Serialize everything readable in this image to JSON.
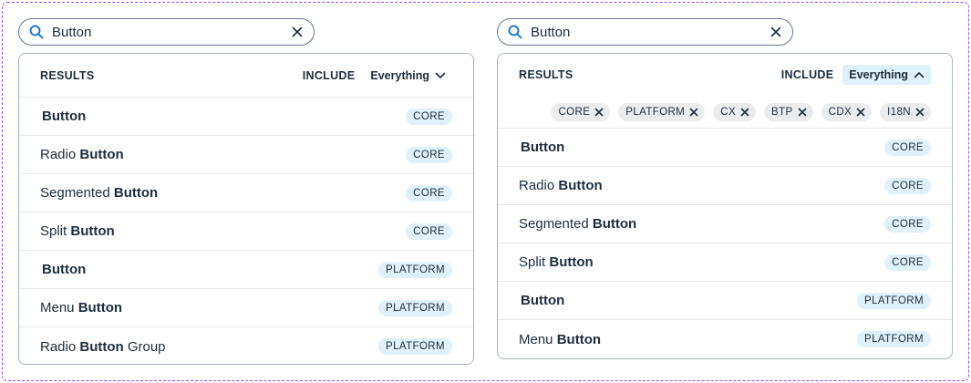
{
  "left": {
    "search": {
      "value": "Button"
    },
    "results_label": "RESULTS",
    "include_label": "INCLUDE",
    "include_value": "Everything",
    "rows": [
      {
        "pre": "",
        "match": "Button",
        "post": "",
        "tag": "CORE"
      },
      {
        "pre": "Radio ",
        "match": "Button",
        "post": "",
        "tag": "CORE"
      },
      {
        "pre": "Segmented ",
        "match": "Button",
        "post": "",
        "tag": "CORE"
      },
      {
        "pre": "Split ",
        "match": "Button",
        "post": "",
        "tag": "CORE"
      },
      {
        "pre": "",
        "match": "Button",
        "post": "",
        "tag": "PLATFORM"
      },
      {
        "pre": "Menu ",
        "match": "Button",
        "post": "",
        "tag": "PLATFORM"
      },
      {
        "pre": "Radio ",
        "match": "Button",
        "post": " Group",
        "tag": "PLATFORM"
      }
    ]
  },
  "right": {
    "search": {
      "value": "Button"
    },
    "results_label": "RESULTS",
    "include_label": "INCLUDE",
    "include_value": "Everything",
    "chips": [
      "CORE",
      "PLATFORM",
      "CX",
      "BTP",
      "CDX",
      "I18N"
    ],
    "rows": [
      {
        "pre": "",
        "match": "Button",
        "post": "",
        "tag": "CORE"
      },
      {
        "pre": "Radio ",
        "match": "Button",
        "post": "",
        "tag": "CORE"
      },
      {
        "pre": "Segmented ",
        "match": "Button",
        "post": "",
        "tag": "CORE"
      },
      {
        "pre": "Split ",
        "match": "Button",
        "post": "",
        "tag": "CORE"
      },
      {
        "pre": "",
        "match": "Button",
        "post": "",
        "tag": "PLATFORM"
      },
      {
        "pre": "Menu ",
        "match": "Button",
        "post": "",
        "tag": "PLATFORM"
      }
    ]
  },
  "colors": {
    "accent_frame": "#9747ff",
    "tag_bg": "#dff1fa",
    "chip_bg": "#eaecee",
    "text": "#1d2d3e",
    "search_icon": "#0a6ed1"
  },
  "icons": {
    "search": "search-icon",
    "clear": "close-icon",
    "chevron_closed": "chevron-down-icon",
    "chevron_open": "chevron-up-icon",
    "chip_remove": "close-icon"
  }
}
